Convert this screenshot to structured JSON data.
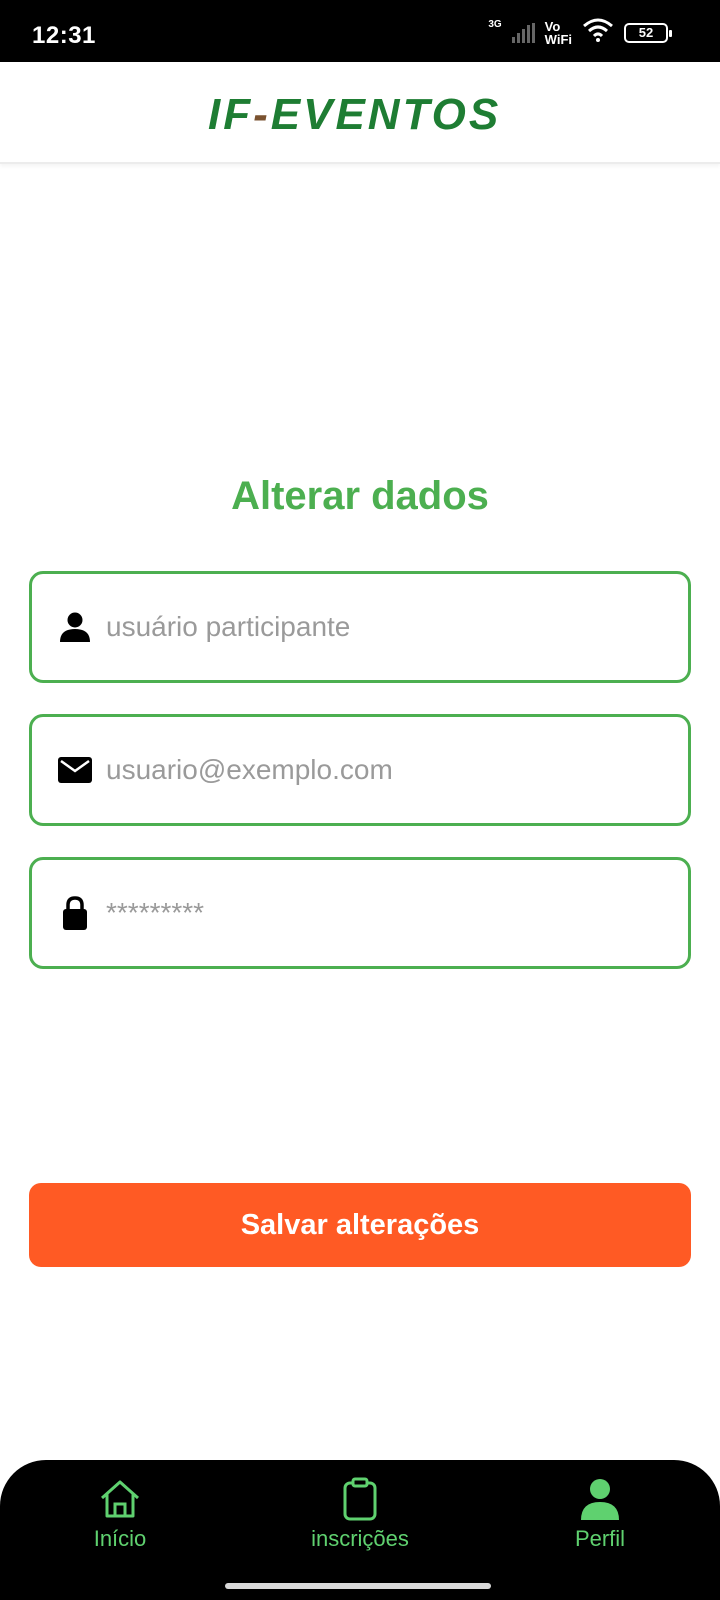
{
  "status_bar": {
    "time": "12:31",
    "network": "3G",
    "vowifi_top": "Vo",
    "vowifi_bottom": "WiFi",
    "battery": "52"
  },
  "header": {
    "logo_part1": "IF",
    "logo_dash": "-",
    "logo_part2": "EVENTOS"
  },
  "main": {
    "title": "Alterar dados",
    "fields": [
      {
        "icon": "user-icon",
        "placeholder": "usuário participante"
      },
      {
        "icon": "envelope-icon",
        "placeholder": "usuario@exemplo.com"
      },
      {
        "icon": "lock-icon",
        "placeholder": "*********"
      }
    ],
    "save_label": "Salvar alterações"
  },
  "bottom_nav": {
    "items": [
      {
        "label": "Início",
        "icon": "home-icon"
      },
      {
        "label": "inscrições",
        "icon": "clipboard-icon"
      },
      {
        "label": "Perfil",
        "icon": "profile-icon",
        "active": true
      }
    ]
  },
  "colors": {
    "accent_green": "#4caf50",
    "nav_green": "#5fd16f",
    "button_orange": "#ff5a24",
    "logo_green": "#1e7d33"
  }
}
